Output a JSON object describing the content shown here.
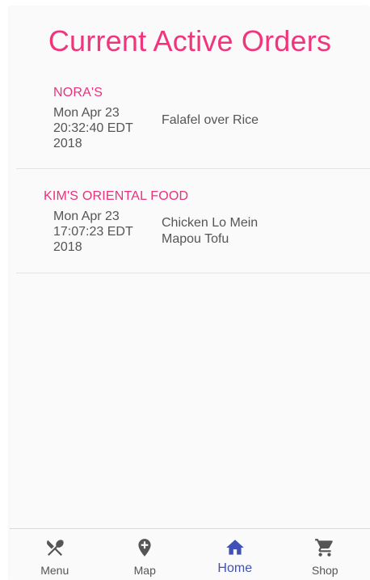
{
  "page": {
    "title": "Current Active Orders"
  },
  "orders": [
    {
      "restaurant": "NORA'S",
      "timestamp": [
        "Mon Apr 23",
        "20:32:40 EDT",
        "2018"
      ],
      "items": [
        "Falafel over Rice"
      ]
    },
    {
      "restaurant": "KIM'S ORIENTAL FOOD",
      "timestamp": [
        "Mon Apr 23",
        "17:07:23 EDT",
        "2018"
      ],
      "items": [
        "Chicken Lo Mein",
        "Mapou Tofu"
      ]
    }
  ],
  "nav": {
    "active": "home",
    "items": [
      {
        "label": "Menu",
        "icon": "fork-knife-icon"
      },
      {
        "label": "Map",
        "icon": "map-pin-icon"
      },
      {
        "label": "Home",
        "icon": "home-icon"
      },
      {
        "label": "Shop",
        "icon": "shopping-cart-icon"
      }
    ]
  },
  "colors": {
    "accent": "#f0357d",
    "active_nav": "#3f51b5",
    "inactive_nav": "#555555",
    "text": "#555555"
  }
}
